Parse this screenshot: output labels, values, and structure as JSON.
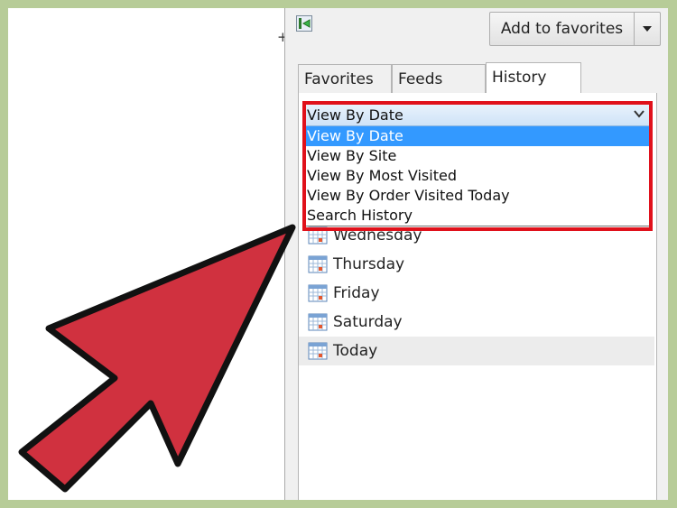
{
  "toolbar": {
    "add_to_favorites_label": "Add to favorites"
  },
  "tabs": [
    {
      "label": "Favorites",
      "active": false
    },
    {
      "label": "Feeds",
      "active": false
    },
    {
      "label": "History",
      "active": true
    }
  ],
  "view_combo": {
    "selected": "View By Date",
    "options": [
      "View By Date",
      "View By Site",
      "View By Most Visited",
      "View By Order Visited Today",
      "Search History"
    ]
  },
  "history_days": [
    {
      "label": "Wednesday"
    },
    {
      "label": "Thursday"
    },
    {
      "label": "Friday"
    },
    {
      "label": "Saturday"
    },
    {
      "label": "Today"
    }
  ],
  "icons": {
    "pin": "pin-to-left-icon",
    "dropdown": "chevron-down-icon",
    "calendar": "calendar-icon",
    "annotation": "red-pointer-arrow"
  },
  "colors": {
    "frame_border": "#b7cc98",
    "highlight_box": "#e0111b",
    "arrow": "#d0313f",
    "selected_option": "#3399ff"
  }
}
